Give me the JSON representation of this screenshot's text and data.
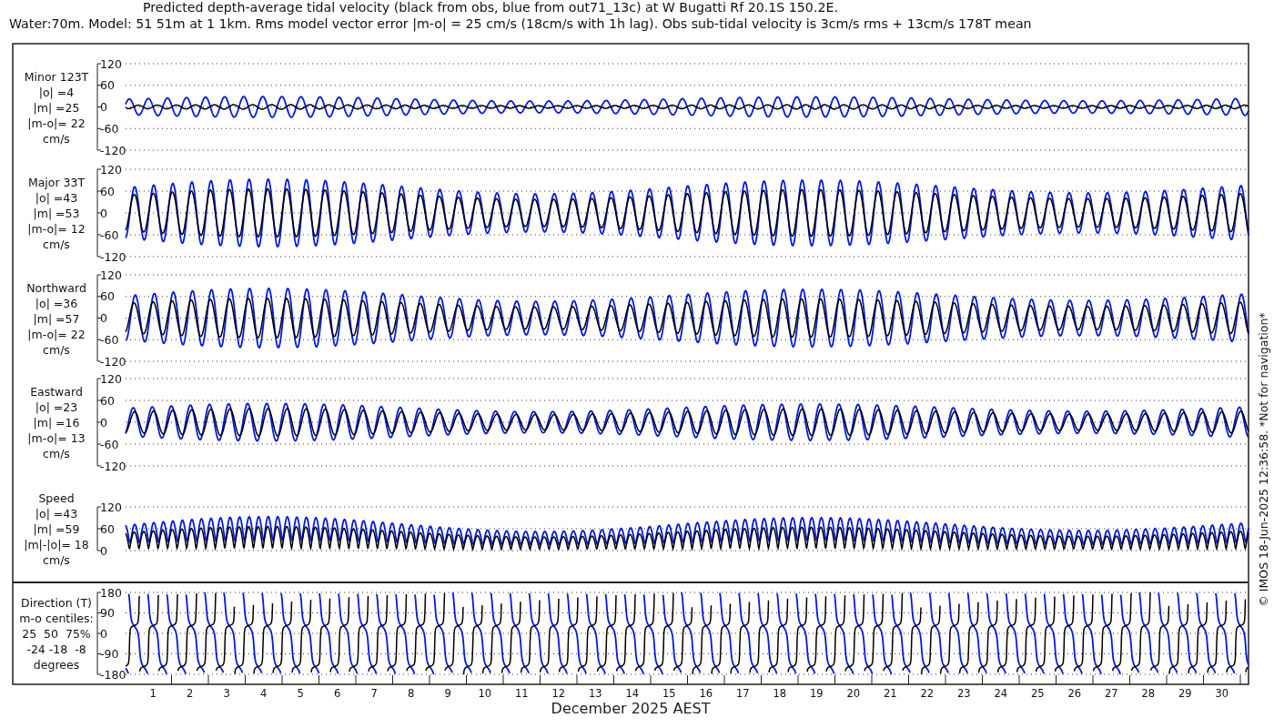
{
  "title": {
    "line_1": "Predicted depth-average tidal velocity (black from obs, blue from out71_13c) at W Bugatti Rf 20.1S 150.2E.",
    "line_2": "Water:70m. Model: 51 51m at 1 1km. Rms model vector error |m-o| = 25 cm/s (18cm/s with 1h lag). Obs sub-tidal velocity is 3cm/s rms + 13cm/s 178T mean"
  },
  "panels": [
    {
      "kind": "minor",
      "label_lines": [
        "Minor 123T",
        "|o| =4",
        "|m| =25",
        "|m-o|= 22",
        "cm/s"
      ],
      "yticks": [
        "120",
        "60",
        "0",
        "-60",
        "-120"
      ]
    },
    {
      "kind": "major",
      "label_lines": [
        "Major 33T",
        "|o| =43",
        "|m| =53",
        "|m-o|= 12",
        "cm/s"
      ],
      "yticks": [
        "120",
        "60",
        "0",
        "-60",
        "-120"
      ]
    },
    {
      "kind": "north",
      "label_lines": [
        "Northward",
        "|o| =36",
        "|m| =57",
        "|m-o|= 22",
        "cm/s"
      ],
      "yticks": [
        "120",
        "60",
        "0",
        "-60",
        "-120"
      ]
    },
    {
      "kind": "east",
      "label_lines": [
        "Eastward",
        "|o| =23",
        "|m| =16",
        "|m-o|= 13",
        "cm/s"
      ],
      "yticks": [
        "120",
        "60",
        "0",
        "-60",
        "-120"
      ]
    },
    {
      "kind": "speed",
      "label_lines": [
        "Speed",
        "|o| =43",
        "|m| =59",
        "|m|-|o|= 18",
        "cm/s"
      ],
      "yticks": [
        "120",
        "60",
        "0"
      ]
    },
    {
      "kind": "direction",
      "label_lines": [
        "Direction (T)",
        "m-o centiles:",
        "25  50  75%",
        "-24 -18  -8",
        "degrees"
      ],
      "yticks": [
        "180",
        "90",
        "0",
        "-90",
        "-180"
      ]
    }
  ],
  "x_axis": {
    "ticks": [
      "1",
      "2",
      "3",
      "4",
      "5",
      "6",
      "7",
      "8",
      "9",
      "10",
      "11",
      "12",
      "13",
      "14",
      "15",
      "16",
      "17",
      "18",
      "19",
      "20",
      "21",
      "22",
      "23",
      "24",
      "25",
      "26",
      "27",
      "28",
      "29",
      "30"
    ],
    "label": "December 2025 AEST"
  },
  "footer": "© IMOS 18-Jun-2025 12:36:58. *Not for navigation*"
}
